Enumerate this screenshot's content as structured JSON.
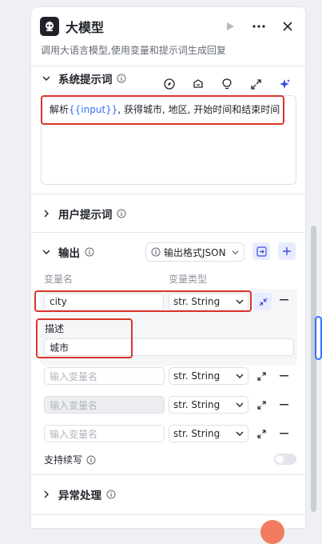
{
  "header": {
    "title": "大模型",
    "description": "调用大语言模型,使用变量和提示词生成回复",
    "icons": [
      "robot-icon",
      "run-icon",
      "more-icon",
      "close-icon"
    ]
  },
  "system_prompt": {
    "title": "系统提示词",
    "text_prefix": "解析",
    "text_variable": "{{input}}",
    "text_suffix": ", 获得城市, 地区, 开始时间和结束时间",
    "tool_icons": [
      "compass-icon",
      "library-icon",
      "lightbulb-icon",
      "expand-icon",
      "sparkle-icon"
    ]
  },
  "user_prompt": {
    "title": "用户提示词"
  },
  "output": {
    "title": "输出",
    "format_label": "输出格式JSON",
    "col_name": "变量名",
    "col_type": "变量类型",
    "rows": [
      {
        "name": "city",
        "type": "str. String",
        "desc_label": "描述",
        "desc_value": "城市"
      },
      {
        "name": "",
        "placeholder": "输入变量名",
        "type": "str. String"
      },
      {
        "name": "",
        "placeholder": "输入变量名",
        "type": "str. String"
      },
      {
        "name": "",
        "placeholder": "输入变量名",
        "type": "str. String"
      }
    ],
    "continue_label": "支持续写",
    "continue_enabled": false
  },
  "exception": {
    "title": "异常处理"
  },
  "colors": {
    "accent": "#3370ff",
    "highlight": "#d9362b",
    "text": "#1f2329",
    "muted": "#646a73"
  }
}
